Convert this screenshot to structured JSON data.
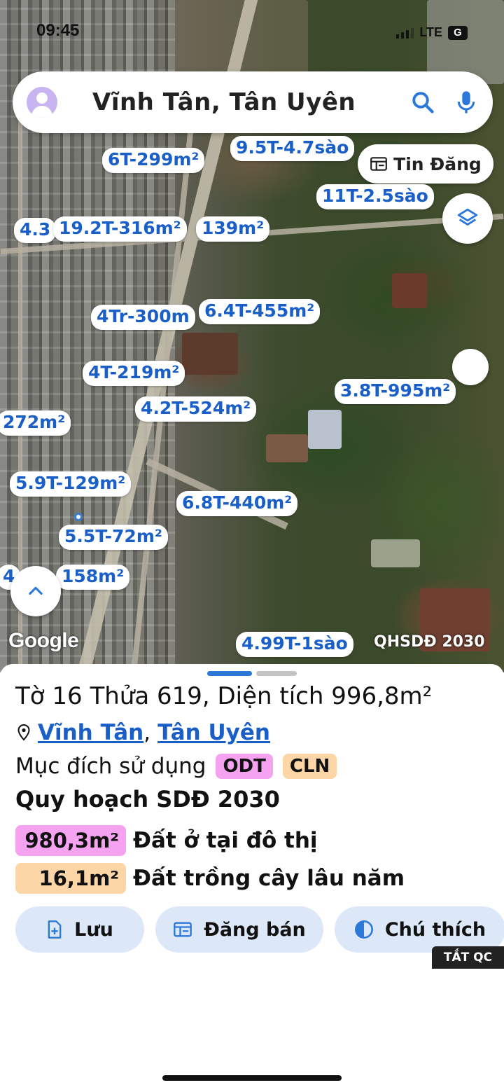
{
  "status_bar": {
    "time": "09:45",
    "network": "LTE",
    "badge": "G"
  },
  "search": {
    "query": "Vĩnh Tân, Tân Uyên"
  },
  "map_controls": {
    "listing_button_label": "Tin Đăng"
  },
  "price_labels": [
    "6T-299m²",
    "9.5T-4.7sào",
    "11T-2.5sào",
    "4.3",
    "19.2T-316m²",
    "139m²",
    "4Tr-300m",
    "6.4T-455m²",
    "4T-219m²",
    "4.2T-524m²",
    "3.8T-995m²",
    "272m²",
    "5.9T-129m²",
    "6.8T-440m²",
    "5.5T-72m²",
    "4",
    "158m²",
    "4.99T-1sào"
  ],
  "map_footer": {
    "google": "Google",
    "layer_name": "QHSDĐ 2030"
  },
  "parcel": {
    "title": "Tờ 16 Thửa 619, Diện tích 996,8m²",
    "ward": "Vĩnh Tân",
    "separator": ",",
    "district": "Tân Uyên",
    "purpose_label": "Mục đích sử dụng",
    "purpose_tags": [
      "ODT",
      "CLN"
    ],
    "plan_heading": "Quy hoạch SDĐ 2030",
    "plan_rows": [
      {
        "area": "980,3m²",
        "description": "Đất ở tại đô thị",
        "color": "#f5a3f0"
      },
      {
        "area": "16,1m²",
        "description": "Đất trồng cây lâu năm",
        "color": "#fdd6a8"
      }
    ]
  },
  "actions": {
    "save": "Lưu",
    "post": "Đăng bán",
    "legend": "Chú thích"
  },
  "ad_toggle": "TẮT QC",
  "colors": {
    "link_blue": "#1a5fc7",
    "pager_active": "#2b78d9",
    "action_bg": "#dce8f8"
  }
}
